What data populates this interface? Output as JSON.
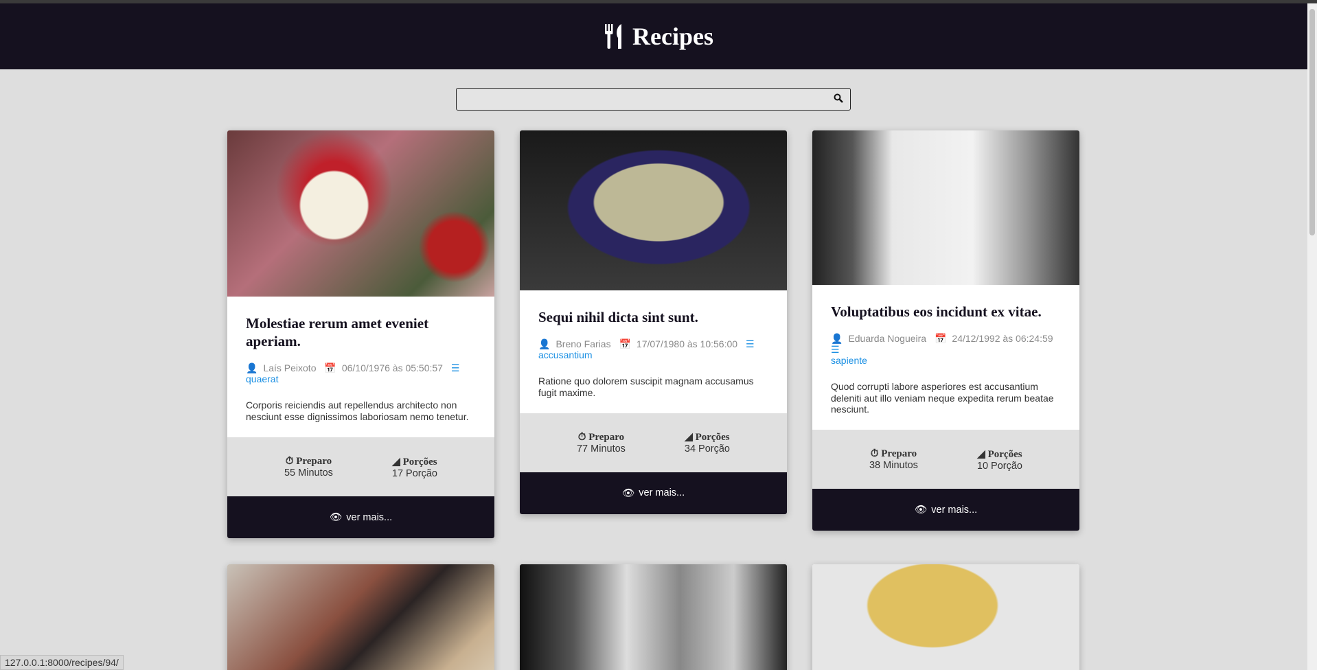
{
  "header": {
    "title": "Recipes",
    "icon": "utensils-icon"
  },
  "search": {
    "value": "",
    "placeholder": ""
  },
  "recipes": [
    {
      "title": "Molestiae rerum amet eveniet aperiam.",
      "author": "Laís Peixoto",
      "date": "06/10/1976 às 05:50:57",
      "category": "quaerat",
      "description": "Corporis reiciendis aut repellendus architecto non nesciunt esse dignissimos laboriosam nemo tenetur.",
      "prep_label": "Preparo",
      "prep": "55 Minutos",
      "serv_label": "Porções",
      "servings": "17 Porção",
      "more": "ver mais..."
    },
    {
      "title": "Sequi nihil dicta sint sunt.",
      "author": "Breno Farias",
      "date": "17/07/1980 às 10:56:00",
      "category": "accusantium",
      "description": "Ratione quo dolorem suscipit magnam accusamus fugit maxime.",
      "prep_label": "Preparo",
      "prep": "77 Minutos",
      "serv_label": "Porções",
      "servings": "34 Porção",
      "more": "ver mais..."
    },
    {
      "title": "Voluptatibus eos incidunt ex vitae.",
      "author": "Eduarda Nogueira",
      "date": "24/12/1992 às 06:24:59",
      "category": "sapiente",
      "description": "Quod corrupti labore asperiores est accusantium deleniti aut illo veniam neque expedita rerum beatae nesciunt.",
      "prep_label": "Preparo",
      "prep": "38 Minutos",
      "serv_label": "Porções",
      "servings": "10 Porção",
      "more": "ver mais..."
    }
  ],
  "status_url": "127.0.0.1:8000/recipes/94/",
  "colors": {
    "header": "#15111f",
    "accent": "#1a8fe3",
    "background": "#dedede"
  }
}
